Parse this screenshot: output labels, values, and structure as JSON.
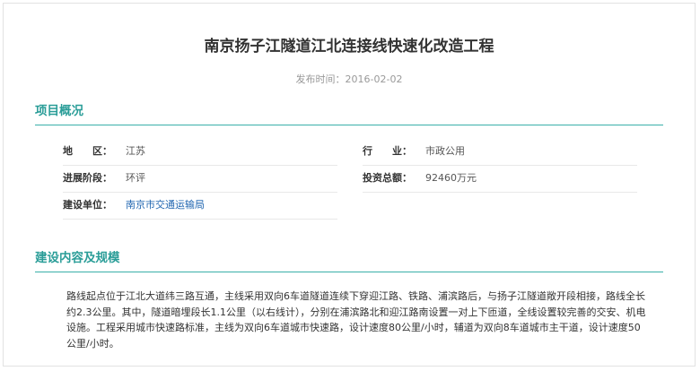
{
  "article": {
    "title": "南京扬子江隧道江北连接线快速化改造工程",
    "publish_date": "发布时间：2016-02-02"
  },
  "overview": {
    "heading": "项目概况",
    "items": [
      {
        "label": "地　　区：",
        "value": "江苏"
      },
      {
        "label": "行　　业：",
        "value": "市政公用"
      },
      {
        "label": "进展阶段：",
        "value": "环评"
      },
      {
        "label": "投资总额：",
        "value": "92460万元"
      },
      {
        "label": "建设单位：",
        "value": "南京市交通运输局"
      }
    ]
  },
  "scope": {
    "heading": "建设内容及规模",
    "text": "路线起点位于江北大道纬三路互通，主线采用双向6车道隧道连续下穿迎江路、铁路、浦滨路后，与扬子江隧道敞开段相接，路线全长约2.3公里。其中，隧道暗埋段长1.1公里（以右线计），分别在浦滨路北和迎江路南设置一对上下匝道，全线设置较完善的交安、机电设施。工程采用城市快速路标准，主线为双向6车道城市快速路，设计速度80公里/小时，辅道为双向8车道城市主干道，设计速度50公里/小时。"
  }
}
